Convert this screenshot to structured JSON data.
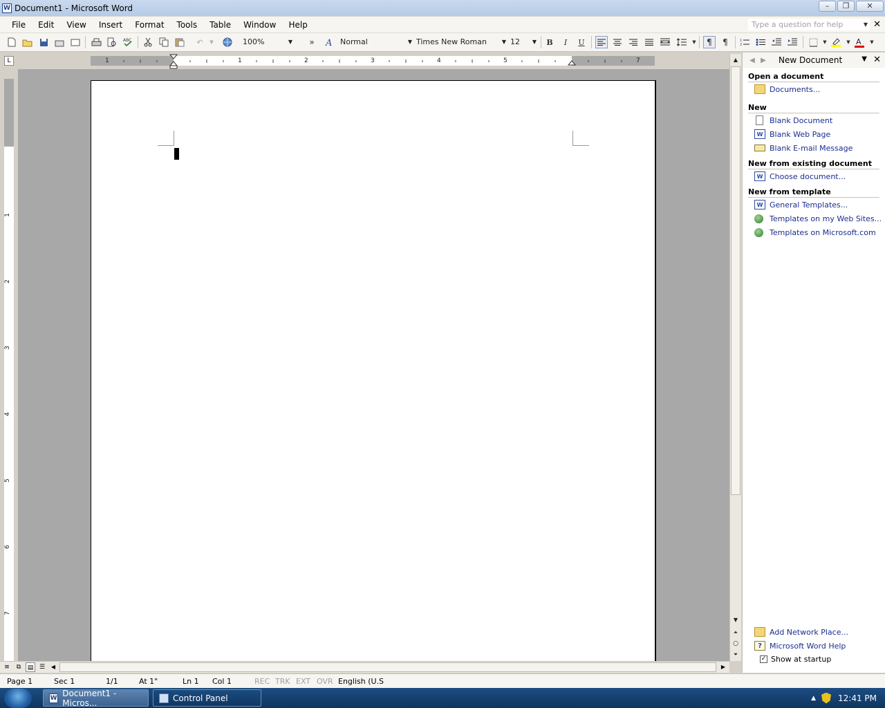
{
  "window": {
    "title": "Document1 - Microsoft Word",
    "app_icon_letter": "W",
    "minimize": "–",
    "restore": "❐",
    "close": "✕"
  },
  "menu": {
    "items": [
      "File",
      "Edit",
      "View",
      "Insert",
      "Format",
      "Tools",
      "Table",
      "Window",
      "Help"
    ],
    "help_placeholder": "Type a question for help",
    "doc_close": "✕"
  },
  "toolbar": {
    "zoom": "100%",
    "style": "Normal",
    "font": "Times New Roman",
    "size": "12",
    "bold": "B",
    "italic": "I",
    "underline": "U",
    "more": "»"
  },
  "ruler": {
    "numbers": [
      "1",
      "1",
      "2",
      "3",
      "4",
      "5",
      "7"
    ],
    "corner": "L"
  },
  "vruler": {
    "numbers": [
      "1",
      "2",
      "3",
      "4",
      "5",
      "6",
      "7"
    ]
  },
  "taskpane": {
    "title": "New Document",
    "sections": [
      {
        "heading": "Open a document",
        "links": [
          {
            "label": "Documents...",
            "icon": "folder-icon"
          }
        ]
      },
      {
        "heading": "New",
        "links": [
          {
            "label": "Blank Document",
            "icon": "blank-document-icon"
          },
          {
            "label": "Blank Web Page",
            "icon": "web-page-icon"
          },
          {
            "label": "Blank E-mail Message",
            "icon": "email-icon"
          }
        ]
      },
      {
        "heading": "New from existing document",
        "links": [
          {
            "label": "Choose document...",
            "icon": "word-document-icon"
          }
        ]
      },
      {
        "heading": "New from template",
        "links": [
          {
            "label": "General Templates...",
            "icon": "word-document-icon"
          },
          {
            "label": "Templates on my Web Sites...",
            "icon": "web-templates-icon"
          },
          {
            "label": "Templates on Microsoft.com",
            "icon": "globe-icon"
          }
        ]
      }
    ],
    "bottom": {
      "add_network_place": "Add Network Place...",
      "word_help": "Microsoft Word Help",
      "show_at_startup": "Show at startup",
      "show_at_startup_checked": true
    }
  },
  "statusbar": {
    "page": "Page  1",
    "sec": "Sec  1",
    "pages": "1/1",
    "at": "At  1\"",
    "ln": "Ln  1",
    "col": "Col  1",
    "rec": "REC",
    "trk": "TRK",
    "ext": "EXT",
    "ovr": "OVR",
    "language": "English (U.S"
  },
  "taskbar": {
    "buttons": [
      {
        "label": "Document1 - Micros...",
        "active": true,
        "icon": "word-icon"
      },
      {
        "label": "Control Panel",
        "active": false,
        "icon": "control-panel-icon"
      }
    ],
    "time": "12:41 PM"
  },
  "colors": {
    "link": "#1b2d8e",
    "doc_background": "#a8a8a8",
    "taskbar": "#1c4d82",
    "titlebar": "#c9d9ee"
  }
}
